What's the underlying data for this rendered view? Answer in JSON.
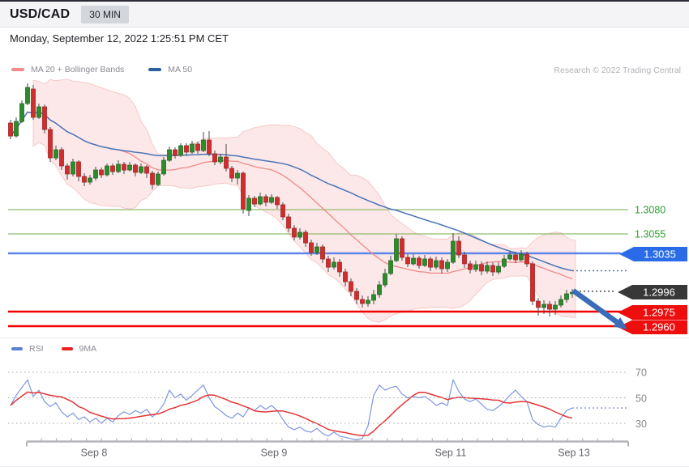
{
  "header": {
    "symbol": "USD/CAD",
    "timeframe": "30 MIN"
  },
  "datetime": "Monday, September 12, 2022 1:25:51 PM CET",
  "legend": {
    "ma20": "MA 20 + Bollinger Bands",
    "ma50": "MA 50",
    "rsi": "RSI",
    "rsi_ma": "9MA",
    "research": "Research © 2022 Trading Central"
  },
  "colors": {
    "candle_up": "#2c8c2c",
    "candle_up_stroke": "#256b25",
    "candle_down": "#d02e2e",
    "candle_down_stroke": "#a32222",
    "wick": "#4a4a50",
    "band_fill": "rgba(242,160,160,0.24)",
    "band_edge": "rgba(240,150,150,0.55)",
    "ma20_line": "#ef8989",
    "ma50_line": "#4a74b8",
    "level_green": "#8fbc6f",
    "level_green_text": "#2e9e2e",
    "level_blue": "#5c86e8",
    "badge_blue": "#2a6ce8",
    "badge_dark": "#383838",
    "level_red": "#f20000",
    "rsi_line": "#7d97e0",
    "rsi_ma_line": "#e43535",
    "grid_dotted": "#a5a5ab",
    "axis": "#b4b4ba",
    "arrow": "#3a6cb8"
  },
  "chart_data": {
    "type": "candlestick",
    "symbol": "USD/CAD",
    "interval": "30 MIN",
    "x_labels": [
      "Sep 8",
      "Sep 9",
      "Sep 11",
      "Sep 13"
    ],
    "rsi_axis": [
      70,
      50,
      30
    ],
    "indicators": {
      "ma_short": 20,
      "ma_long": 50,
      "bollinger_k": 2,
      "rsi_period": 14,
      "rsi_ma": 9
    },
    "levels": [
      {
        "label": "1.3080",
        "price": 1.308,
        "kind": "resistance",
        "line_color": "#8fbc6f",
        "badge": null
      },
      {
        "label": "1.3055",
        "price": 1.3055,
        "kind": "resistance",
        "line_color": "#8fbc6f",
        "badge": null
      },
      {
        "label": "1.3035",
        "price": 1.3035,
        "kind": "pivot",
        "line_color": "#5c86e8",
        "badge": "#2a6ce8"
      },
      {
        "label": "1.2996",
        "price": 1.2996,
        "kind": "last_price",
        "line_color": "#3a3a3a",
        "badge": "#383838",
        "dotted": true
      },
      {
        "label": "1.2975",
        "price": 1.2975,
        "kind": "support",
        "line_color": "#f20000",
        "badge": "#ee0e0e"
      },
      {
        "label": "1.2960",
        "price": 1.296,
        "kind": "support",
        "line_color": "#f20000",
        "badge": "#ee0e0e"
      }
    ],
    "annotation": {
      "type": "down-arrow",
      "meaning": "bearish continuation toward 1.2960"
    },
    "candles": [
      [
        1.31692,
        1.31725,
        1.31525,
        1.31558
      ],
      [
        1.31558,
        1.3175,
        1.31542,
        1.31708
      ],
      [
        1.31708,
        1.31925,
        1.31692,
        1.31892
      ],
      [
        1.31892,
        1.321,
        1.31875,
        1.32058
      ],
      [
        1.32042,
        1.32083,
        1.31725,
        1.3175
      ],
      [
        1.3175,
        1.31892,
        1.31733,
        1.31858
      ],
      [
        1.31858,
        1.31883,
        1.31583,
        1.31625
      ],
      [
        1.31625,
        1.3165,
        1.31292,
        1.31333
      ],
      [
        1.31333,
        1.31458,
        1.31308,
        1.31417
      ],
      [
        1.31417,
        1.31442,
        1.31208,
        1.3125
      ],
      [
        1.3125,
        1.31275,
        1.31108,
        1.31167
      ],
      [
        1.31167,
        1.31325,
        1.31142,
        1.31292
      ],
      [
        1.31292,
        1.31308,
        1.31092,
        1.31142
      ],
      [
        1.31142,
        1.31175,
        1.31042,
        1.31083
      ],
      [
        1.31083,
        1.31158,
        1.31058,
        1.31125
      ],
      [
        1.31125,
        1.31242,
        1.311,
        1.31208
      ],
      [
        1.31208,
        1.31233,
        1.31125,
        1.31158
      ],
      [
        1.31158,
        1.31275,
        1.31142,
        1.3125
      ],
      [
        1.3125,
        1.31275,
        1.31158,
        1.31192
      ],
      [
        1.31192,
        1.31308,
        1.31175,
        1.31267
      ],
      [
        1.31267,
        1.31292,
        1.31167,
        1.31208
      ],
      [
        1.31208,
        1.31292,
        1.31192,
        1.31258
      ],
      [
        1.31258,
        1.31275,
        1.31142,
        1.31183
      ],
      [
        1.31183,
        1.31275,
        1.31167,
        1.31242
      ],
      [
        1.31242,
        1.31258,
        1.31125,
        1.31175
      ],
      [
        1.31175,
        1.312,
        1.31008,
        1.31058
      ],
      [
        1.31058,
        1.31192,
        1.31042,
        1.31167
      ],
      [
        1.31167,
        1.31342,
        1.3115,
        1.31308
      ],
      [
        1.31308,
        1.3145,
        1.31292,
        1.31417
      ],
      [
        1.31417,
        1.31442,
        1.31325,
        1.31358
      ],
      [
        1.31358,
        1.31483,
        1.31342,
        1.31458
      ],
      [
        1.31458,
        1.31483,
        1.31358,
        1.31392
      ],
      [
        1.31392,
        1.31508,
        1.31375,
        1.31475
      ],
      [
        1.31475,
        1.315,
        1.31375,
        1.31408
      ],
      [
        1.31408,
        1.316,
        1.31392,
        1.31517
      ],
      [
        1.31517,
        1.31608,
        1.3135,
        1.31375
      ],
      [
        1.31375,
        1.31408,
        1.31258,
        1.31292
      ],
      [
        1.31292,
        1.31375,
        1.31267,
        1.31342
      ],
      [
        1.31342,
        1.31475,
        1.31192,
        1.31225
      ],
      [
        1.31225,
        1.3125,
        1.31083,
        1.31125
      ],
      [
        1.31125,
        1.31208,
        1.31058,
        1.31175
      ],
      [
        1.31175,
        1.31192,
        1.30758,
        1.30808
      ],
      [
        1.30792,
        1.3095,
        1.30733,
        1.30917
      ],
      [
        1.30917,
        1.30942,
        1.30825,
        1.30858
      ],
      [
        1.30858,
        1.30975,
        1.30842,
        1.30933
      ],
      [
        1.30933,
        1.30958,
        1.30833,
        1.30875
      ],
      [
        1.30875,
        1.30958,
        1.30858,
        1.30925
      ],
      [
        1.30925,
        1.30942,
        1.30808,
        1.3085
      ],
      [
        1.3085,
        1.30875,
        1.30692,
        1.30725
      ],
      [
        1.30725,
        1.30758,
        1.30567,
        1.30608
      ],
      [
        1.30608,
        1.30642,
        1.30483,
        1.30517
      ],
      [
        1.30517,
        1.30608,
        1.30492,
        1.30567
      ],
      [
        1.30567,
        1.30592,
        1.30417,
        1.30458
      ],
      [
        1.30458,
        1.30492,
        1.30325,
        1.30358
      ],
      [
        1.30358,
        1.30458,
        1.30333,
        1.30417
      ],
      [
        1.30417,
        1.30442,
        1.3025,
        1.30292
      ],
      [
        1.30292,
        1.30325,
        1.30158,
        1.30208
      ],
      [
        1.30208,
        1.30308,
        1.30183,
        1.30258
      ],
      [
        1.30258,
        1.30292,
        1.30108,
        1.30158
      ],
      [
        1.30158,
        1.30192,
        1.30008,
        1.30058
      ],
      [
        1.30058,
        1.30092,
        1.29908,
        1.29958
      ],
      [
        1.29958,
        1.29992,
        1.29825,
        1.29875
      ],
      [
        1.29875,
        1.29917,
        1.29792,
        1.29833
      ],
      [
        1.29833,
        1.29908,
        1.298,
        1.29867
      ],
      [
        1.29867,
        1.29975,
        1.29825,
        1.29925
      ],
      [
        1.29925,
        1.30067,
        1.29892,
        1.30025
      ],
      [
        1.30025,
        1.30192,
        1.3,
        1.30142
      ],
      [
        1.30142,
        1.30325,
        1.30125,
        1.30275
      ],
      [
        1.30275,
        1.3055,
        1.30258,
        1.305
      ],
      [
        1.305,
        1.30525,
        1.30275,
        1.30308
      ],
      [
        1.30308,
        1.30342,
        1.30208,
        1.30242
      ],
      [
        1.30242,
        1.30342,
        1.30225,
        1.303
      ],
      [
        1.303,
        1.30325,
        1.30192,
        1.30225
      ],
      [
        1.30225,
        1.30333,
        1.30208,
        1.30292
      ],
      [
        1.30292,
        1.30317,
        1.30167,
        1.30208
      ],
      [
        1.30208,
        1.30317,
        1.30183,
        1.30275
      ],
      [
        1.30275,
        1.30308,
        1.30142,
        1.30192
      ],
      [
        1.30192,
        1.30292,
        1.30158,
        1.30258
      ],
      [
        1.30258,
        1.30558,
        1.30242,
        1.30475
      ],
      [
        1.30475,
        1.30525,
        1.303,
        1.30333
      ],
      [
        1.30333,
        1.30367,
        1.302,
        1.30242
      ],
      [
        1.30242,
        1.30275,
        1.30142,
        1.30183
      ],
      [
        1.30183,
        1.30275,
        1.30158,
        1.30233
      ],
      [
        1.30233,
        1.30267,
        1.30125,
        1.30167
      ],
      [
        1.30167,
        1.30267,
        1.30142,
        1.30225
      ],
      [
        1.30225,
        1.30258,
        1.30117,
        1.30158
      ],
      [
        1.30158,
        1.30258,
        1.30133,
        1.30217
      ],
      [
        1.30217,
        1.30333,
        1.302,
        1.30292
      ],
      [
        1.30292,
        1.30375,
        1.30275,
        1.30333
      ],
      [
        1.30333,
        1.30367,
        1.3025,
        1.30283
      ],
      [
        1.30283,
        1.30383,
        1.30267,
        1.30342
      ],
      [
        1.30342,
        1.30367,
        1.30208,
        1.30242
      ],
      [
        1.30242,
        1.30267,
        1.29817,
        1.29858
      ],
      [
        1.29858,
        1.29892,
        1.29708,
        1.29792
      ],
      [
        1.29792,
        1.29867,
        1.29725,
        1.29825
      ],
      [
        1.29825,
        1.29858,
        1.297,
        1.29775
      ],
      [
        1.29775,
        1.29858,
        1.29717,
        1.29817
      ],
      [
        1.29817,
        1.29917,
        1.29792,
        1.29875
      ],
      [
        1.29875,
        1.29975,
        1.29842,
        1.29933
      ],
      [
        1.29933,
        1.29983,
        1.29892,
        1.2995
      ]
    ],
    "rsi": [
      44,
      52,
      58,
      64,
      51,
      56,
      47,
      43,
      46,
      39,
      35,
      38,
      33,
      35,
      31,
      34,
      30,
      34,
      31,
      36,
      39,
      37,
      40,
      38,
      41,
      35,
      39,
      45,
      56,
      50,
      53,
      48,
      52,
      56,
      60,
      50,
      43,
      40,
      36,
      34,
      38,
      35,
      42,
      40,
      44,
      41,
      44,
      40,
      33,
      27,
      25,
      27,
      24,
      23,
      26,
      22,
      20,
      23,
      20,
      19,
      18,
      17,
      18,
      28,
      52,
      60,
      56,
      58,
      59,
      53,
      50,
      51,
      50,
      51,
      48,
      44,
      46,
      44,
      64,
      55,
      49,
      47,
      49,
      45,
      41,
      40,
      43,
      47,
      52,
      56,
      51,
      47,
      33,
      29,
      27,
      28,
      27,
      34,
      40,
      42
    ]
  }
}
